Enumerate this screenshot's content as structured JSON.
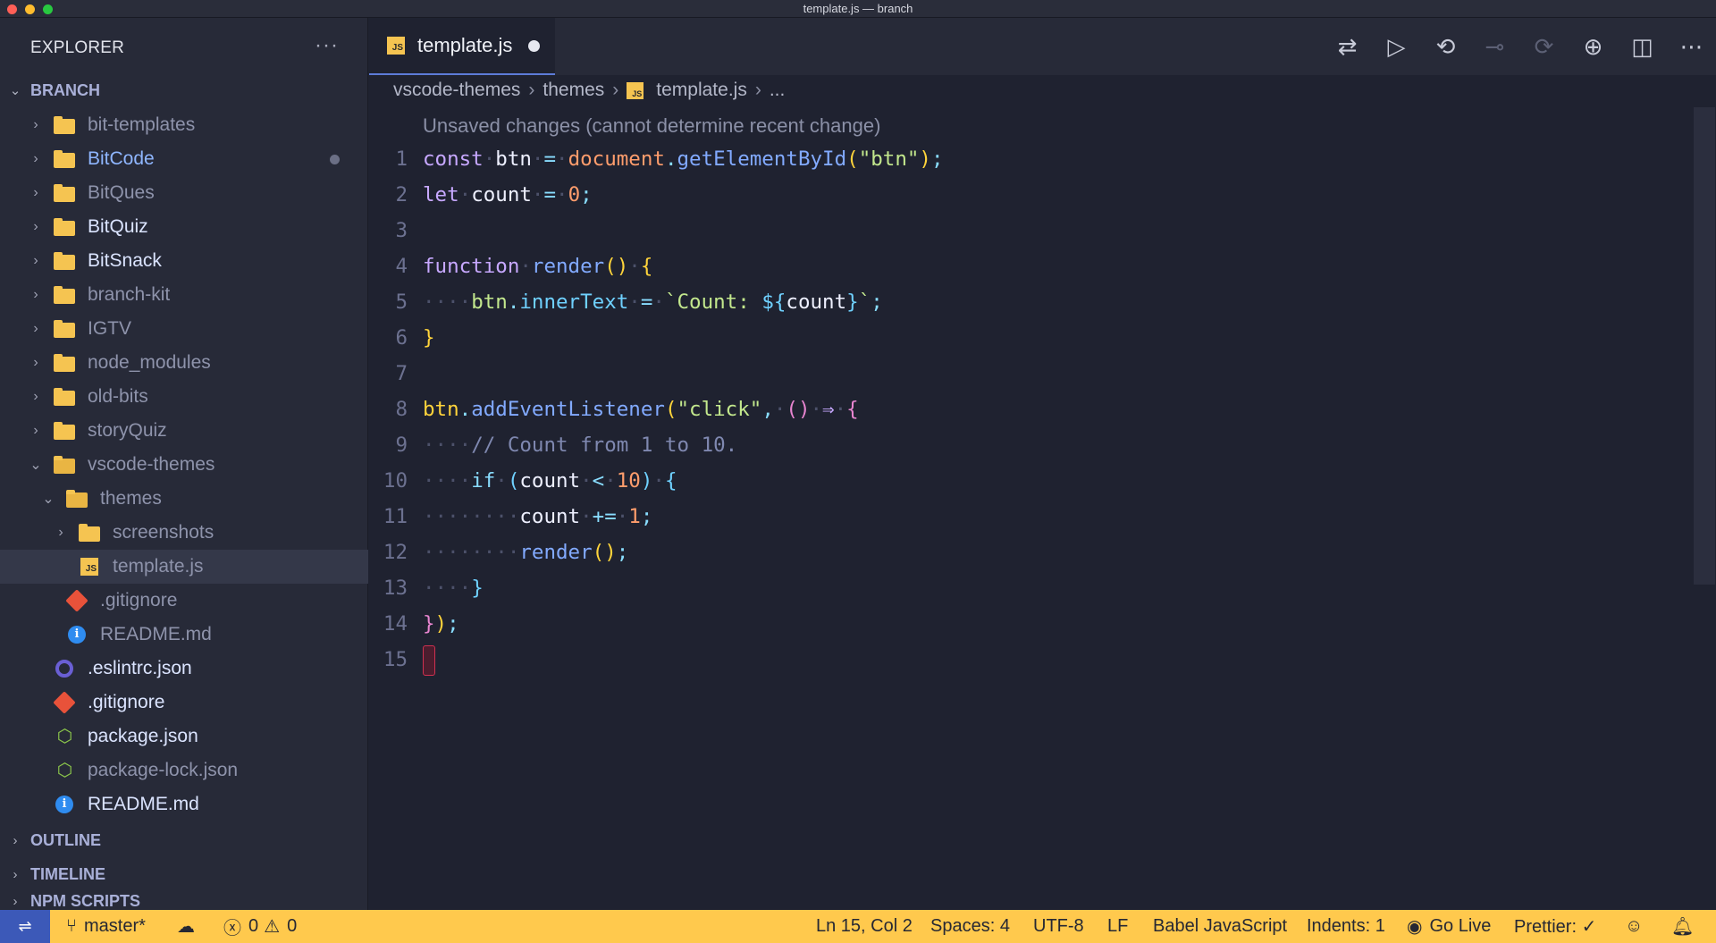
{
  "window": {
    "title": "template.js — branch"
  },
  "explorer": {
    "title": "EXPLORER",
    "more_icon": "ellipsis-icon",
    "root_label": "BRANCH",
    "items": [
      {
        "name": "bit-templates",
        "type": "folder"
      },
      {
        "name": "BitCode",
        "type": "folder",
        "modified": true
      },
      {
        "name": "BitQues",
        "type": "folder"
      },
      {
        "name": "BitQuiz",
        "type": "folder"
      },
      {
        "name": "BitSnack",
        "type": "folder"
      },
      {
        "name": "branch-kit",
        "type": "folder"
      },
      {
        "name": "IGTV",
        "type": "folder"
      },
      {
        "name": "node_modules",
        "type": "folder"
      },
      {
        "name": "old-bits",
        "type": "folder"
      },
      {
        "name": "storyQuiz",
        "type": "folder"
      },
      {
        "name": "vscode-themes",
        "type": "folder",
        "expanded": true
      },
      {
        "name": "themes",
        "type": "folder",
        "expanded": true
      },
      {
        "name": "screenshots",
        "type": "folder"
      },
      {
        "name": "template.js",
        "type": "js",
        "selected": true
      },
      {
        "name": ".gitignore",
        "type": "git"
      },
      {
        "name": "README.md",
        "type": "info"
      },
      {
        "name": ".eslintrc.json",
        "type": "eslint"
      },
      {
        "name": ".gitignore",
        "type": "git"
      },
      {
        "name": "package.json",
        "type": "node"
      },
      {
        "name": "package-lock.json",
        "type": "node"
      },
      {
        "name": "README.md",
        "type": "info"
      }
    ],
    "sections": [
      "OUTLINE",
      "TIMELINE",
      "NPM SCRIPTS"
    ]
  },
  "tabs": [
    {
      "label": "template.js",
      "icon": "js-file-icon",
      "unsaved": true
    }
  ],
  "editor_actions": [
    {
      "icon": "git-compare-icon",
      "enabled": true
    },
    {
      "icon": "run-icon",
      "enabled": true
    },
    {
      "icon": "go-back-icon",
      "enabled": true
    },
    {
      "icon": "commit-node-icon",
      "enabled": false
    },
    {
      "icon": "go-forward-icon",
      "enabled": false
    },
    {
      "icon": "git-lens-icon",
      "enabled": true
    },
    {
      "icon": "split-editor-icon",
      "enabled": true
    },
    {
      "icon": "more-actions-icon",
      "enabled": true
    }
  ],
  "breadcrumbs": [
    "vscode-themes",
    "themes",
    "template.js",
    "..."
  ],
  "codelens": "Unsaved changes (cannot determine recent change)",
  "code": {
    "line_numbers": [
      "1",
      "2",
      "3",
      "4",
      "5",
      "6",
      "7",
      "8",
      "9",
      "10",
      "11",
      "12",
      "13",
      "14",
      "15"
    ],
    "l1": {
      "kw": "const",
      "var": "btn",
      "op": "=",
      "obj": "document",
      "fn": "getElementById",
      "str": "\"btn\""
    },
    "l2": {
      "kw": "let",
      "var": "count",
      "op": "=",
      "num": "0"
    },
    "l4": {
      "kw": "function",
      "fn": "render"
    },
    "l5": {
      "obj": "btn",
      "prop": "innerText",
      "op": "=",
      "tpl_start": "`Count: ",
      "tpl_var": "count",
      "tpl_end": "`"
    },
    "l8": {
      "obj": "btn",
      "fn": "addEventListener",
      "str": "\"click\"",
      "arrow": "⇒"
    },
    "l9": {
      "comment": "// Count from 1 to 10."
    },
    "l10": {
      "kw": "if",
      "var": "count",
      "op": "<",
      "num": "10"
    },
    "l11": {
      "var": "count",
      "op": "+=",
      "num": "1"
    },
    "l12": {
      "fn": "render"
    }
  },
  "status": {
    "remote_icon": "remote-icon",
    "branch": "master*",
    "sync_icon": "cloud-sync-icon",
    "errors": "0",
    "warnings": "0",
    "position": "Ln 15, Col 2",
    "spaces": "Spaces: 4",
    "encoding": "UTF-8",
    "eol": "LF",
    "language": "Babel JavaScript",
    "indents": "Indents: 1",
    "golive": "Go Live",
    "prettier": "Prettier: ✓"
  },
  "colors": {
    "accent": "#ffc94d",
    "sidebar_bg": "#272a38",
    "editor_bg": "#1f2230",
    "remote_bg": "#3c59b8"
  }
}
